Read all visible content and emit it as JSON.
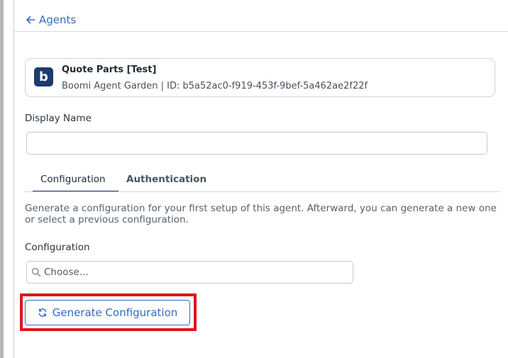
{
  "header": {
    "back_label": "Agents"
  },
  "agent": {
    "logo_letter": "b",
    "name": "Quote Parts [Test]",
    "meta": "Boomi Agent Garden | ID: b5a52ac0-f919-453f-9bef-5a462ae2f22f"
  },
  "display_name": {
    "label": "Display Name",
    "value": ""
  },
  "tabs": [
    {
      "label": "Configuration",
      "active": true
    },
    {
      "label": "Authentication",
      "active": false
    }
  ],
  "configuration": {
    "description": "Generate a configuration for your first setup of this agent. Afterward, you can generate a new one or select a previous configuration.",
    "label": "Configuration",
    "placeholder": "Choose...",
    "generate_label": "Generate Configuration"
  },
  "colors": {
    "accent": "#2f6cc2",
    "brand": "#1d3b6e",
    "highlight": "#e0151b"
  }
}
